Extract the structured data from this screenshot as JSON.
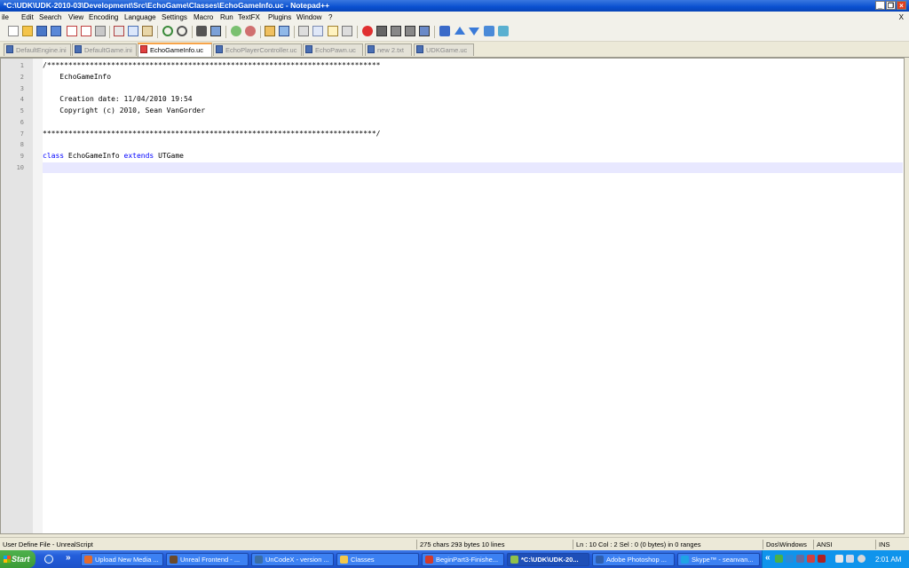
{
  "window": {
    "title": "*C:\\UDK\\UDK-2010-03\\Development\\Src\\EchoGame\\Classes\\EchoGameInfo.uc - Notepad++",
    "minimize_label": "_",
    "maximize_label": "❐",
    "close_label": "×"
  },
  "menu": {
    "items": [
      "ile",
      "Edit",
      "Search",
      "View",
      "Encoding",
      "Language",
      "Settings",
      "Macro",
      "Run",
      "TextFX",
      "Plugins",
      "Window",
      "?"
    ],
    "doc_close_label": "X"
  },
  "tabs": [
    {
      "label": "DefaultEngine.ini",
      "active": false
    },
    {
      "label": "DefaultGame.ini",
      "active": false
    },
    {
      "label": "EchoGameInfo.uc",
      "active": true
    },
    {
      "label": "EchoPlayerController.uc",
      "active": false
    },
    {
      "label": "EchoPawn.uc",
      "active": false
    },
    {
      "label": "new  2.txt",
      "active": false
    },
    {
      "label": "UDKGame.uc",
      "active": false
    }
  ],
  "editor": {
    "line_numbers": [
      "1",
      "2",
      "3",
      "4",
      "5",
      "6",
      "7",
      "8",
      "9",
      "10"
    ],
    "lines": [
      "/******************************************************************************",
      "    EchoGameInfo",
      "",
      "    Creation date: 11/04/2010 19:54",
      "    Copyright (c) 2010, Sean VanGorder",
      "",
      "******************************************************************************/",
      "",
      "",
      ""
    ],
    "line9": {
      "kw1": "class",
      "ident1": " EchoGameInfo ",
      "kw2": "extends",
      "ident2": " UTGame"
    }
  },
  "status": {
    "file_type": "User Define File - UnrealScript",
    "size": "275 chars   293 bytes   10 lines",
    "position": "Ln : 10    Col : 2    Sel : 0 (0 bytes) in 0 ranges",
    "eol": "Dos\\Windows",
    "encoding": "ANSI",
    "mode": "INS"
  },
  "taskbar": {
    "start_label": "Start",
    "more_label": "»",
    "tasks": [
      {
        "label": "Upload New Media ...",
        "color": "#e36b2c"
      },
      {
        "label": "Unreal Frontend - ...",
        "color": "#6b4a2a"
      },
      {
        "label": "UnCodeX - version ...",
        "color": "#3b6ea5"
      },
      {
        "label": "Classes",
        "color": "#f2c84b"
      },
      {
        "label": "BeginPart3-Finishe...",
        "color": "#d23b2b"
      },
      {
        "label": "*C:\\UDK\\UDK-20...",
        "color": "#8fc04a"
      },
      {
        "label": "Adobe Photoshop ...",
        "color": "#2f5fae"
      },
      {
        "label": "Skype™ - seanvan...",
        "color": "#1fa3e5"
      }
    ],
    "tray_more": "«",
    "clock": "2:01 AM"
  }
}
